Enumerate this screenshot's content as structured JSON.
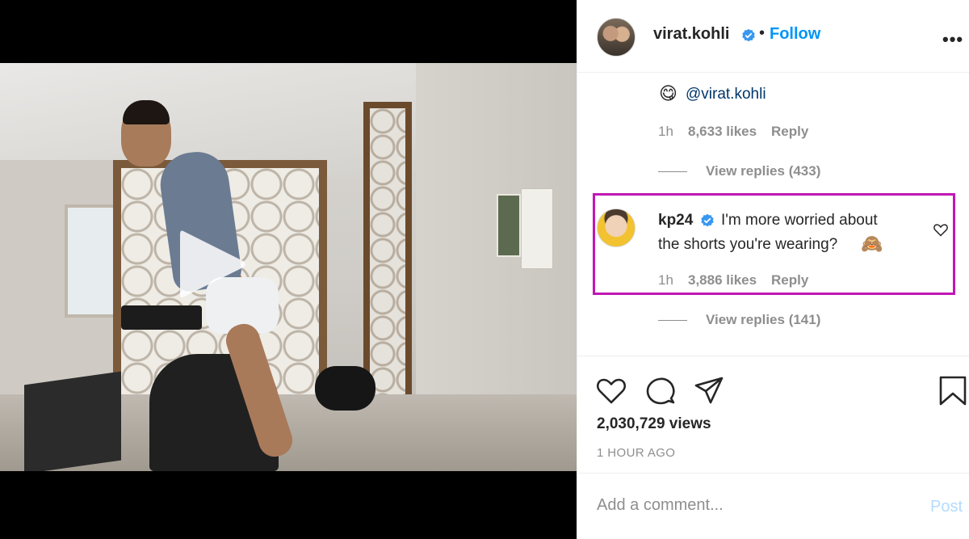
{
  "post": {
    "username": "virat.kohli",
    "separator": "•",
    "follow_label": "Follow",
    "more_label": "•••"
  },
  "comments": [
    {
      "emoji": "😋",
      "mention": "@virat.kohli",
      "time": "1h",
      "likes": "8,633 likes",
      "reply_label": "Reply",
      "view_replies": "View replies (433)"
    },
    {
      "username": "kp24",
      "text_line1": "I'm more worried about",
      "text_line2": "the shorts you're wearing?",
      "emoji": "🙈",
      "time": "1h",
      "likes": "3,886 likes",
      "reply_label": "Reply",
      "view_replies": "View replies (141)"
    }
  ],
  "stats": {
    "views": "2,030,729 views",
    "time_ago": "1 HOUR AGO"
  },
  "composer": {
    "placeholder": "Add a comment...",
    "post_label": "Post"
  },
  "colors": {
    "accent": "#0095f6",
    "highlight_border": "#c117b4",
    "muted": "#8e8e8e"
  }
}
